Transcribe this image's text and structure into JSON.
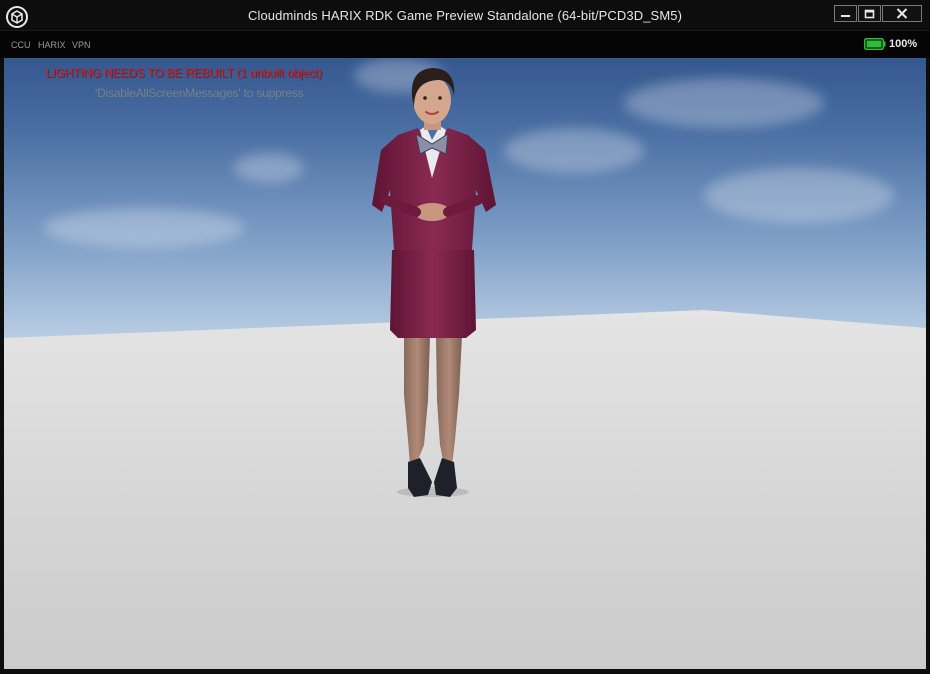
{
  "window": {
    "title": "Cloudminds HARIX RDK Game Preview Standalone (64-bit/PCD3D_SM5)",
    "logo_icon": "unreal-engine-logo-icon",
    "controls": [
      "minimize-icon",
      "maximize-icon",
      "close-icon"
    ]
  },
  "toolbar": {
    "menu": [
      "CCU",
      "HARIX",
      "VPN"
    ],
    "battery": {
      "icon": "battery-icon",
      "level_percent": 100,
      "label": "100%",
      "color": "#2ebd3a"
    }
  },
  "viewport": {
    "screen_messages": {
      "warning": "LIGHTING NEEDS TO BE REBUILT (1 unbuilt object)",
      "hint": "'DisableAllScreenMessages' to suppress"
    },
    "colors": {
      "warning_text": "#e8120c",
      "suit": "#7a1f45",
      "floor": "#d4d4d4",
      "sky_top": "#34578f"
    }
  }
}
